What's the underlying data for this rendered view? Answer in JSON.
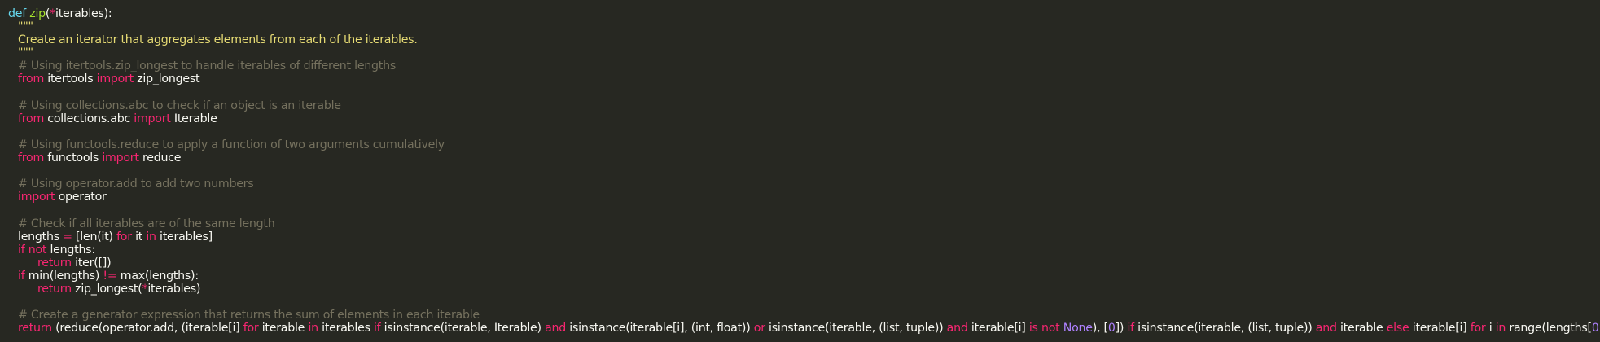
{
  "editor": {
    "background": "#272822",
    "theme_colors": {
      "keyword": "#f92672",
      "storage": "#66d9ef",
      "function": "#a6e22e",
      "string": "#e6db74",
      "comment": "#75715e",
      "number": "#ae81ff",
      "text": "#f8f8f2"
    },
    "lines": [
      {
        "indent": 0,
        "tokens": [
          {
            "t": "def",
            "c": "def"
          },
          {
            "t": " ",
            "c": "txt"
          },
          {
            "t": "zip",
            "c": "fn"
          },
          {
            "t": "(",
            "c": "txt"
          },
          {
            "t": "*",
            "c": "op"
          },
          {
            "t": "iterables):",
            "c": "txt"
          }
        ]
      },
      {
        "indent": 1,
        "tokens": [
          {
            "t": "\"\"\"",
            "c": "str"
          }
        ]
      },
      {
        "indent": 1,
        "tokens": [
          {
            "t": "Create an iterator that aggregates elements from each of the iterables.",
            "c": "str"
          }
        ]
      },
      {
        "indent": 1,
        "tokens": [
          {
            "t": "\"\"\"",
            "c": "str"
          }
        ]
      },
      {
        "indent": 1,
        "tokens": [
          {
            "t": "# Using itertools.zip_longest to handle iterables of different lengths",
            "c": "cm"
          }
        ]
      },
      {
        "indent": 1,
        "tokens": [
          {
            "t": "from",
            "c": "kw"
          },
          {
            "t": " itertools ",
            "c": "txt"
          },
          {
            "t": "import",
            "c": "kw"
          },
          {
            "t": " zip_longest",
            "c": "txt"
          }
        ]
      },
      {
        "indent": 1,
        "tokens": []
      },
      {
        "indent": 1,
        "tokens": [
          {
            "t": "# Using collections.abc to check if an object is an iterable",
            "c": "cm"
          }
        ]
      },
      {
        "indent": 1,
        "tokens": [
          {
            "t": "from",
            "c": "kw"
          },
          {
            "t": " collections.abc ",
            "c": "txt"
          },
          {
            "t": "import",
            "c": "kw"
          },
          {
            "t": " Iterable",
            "c": "txt"
          }
        ]
      },
      {
        "indent": 1,
        "tokens": []
      },
      {
        "indent": 1,
        "tokens": [
          {
            "t": "# Using functools.reduce to apply a function of two arguments cumulatively",
            "c": "cm"
          }
        ]
      },
      {
        "indent": 1,
        "tokens": [
          {
            "t": "from",
            "c": "kw"
          },
          {
            "t": " functools ",
            "c": "txt"
          },
          {
            "t": "import",
            "c": "kw"
          },
          {
            "t": " reduce",
            "c": "txt"
          }
        ]
      },
      {
        "indent": 1,
        "tokens": []
      },
      {
        "indent": 1,
        "tokens": [
          {
            "t": "# Using operator.add to add two numbers",
            "c": "cm"
          }
        ]
      },
      {
        "indent": 1,
        "tokens": [
          {
            "t": "import",
            "c": "kw"
          },
          {
            "t": " operator",
            "c": "txt"
          }
        ]
      },
      {
        "indent": 1,
        "tokens": []
      },
      {
        "indent": 1,
        "tokens": [
          {
            "t": "# Check if all iterables are of the same length",
            "c": "cm"
          }
        ]
      },
      {
        "indent": 1,
        "tokens": [
          {
            "t": "lengths ",
            "c": "txt"
          },
          {
            "t": "=",
            "c": "op"
          },
          {
            "t": " [len(it) ",
            "c": "txt"
          },
          {
            "t": "for",
            "c": "kw"
          },
          {
            "t": " it ",
            "c": "txt"
          },
          {
            "t": "in",
            "c": "kw"
          },
          {
            "t": " iterables]",
            "c": "txt"
          }
        ]
      },
      {
        "indent": 1,
        "tokens": [
          {
            "t": "if",
            "c": "kw"
          },
          {
            "t": " ",
            "c": "txt"
          },
          {
            "t": "not",
            "c": "kw"
          },
          {
            "t": " lengths:",
            "c": "txt"
          }
        ]
      },
      {
        "indent": 2,
        "tokens": [
          {
            "t": "return",
            "c": "kw"
          },
          {
            "t": " iter([])",
            "c": "txt"
          }
        ]
      },
      {
        "indent": 1,
        "tokens": [
          {
            "t": "if",
            "c": "kw"
          },
          {
            "t": " min(lengths) ",
            "c": "txt"
          },
          {
            "t": "!=",
            "c": "op"
          },
          {
            "t": " max(lengths):",
            "c": "txt"
          }
        ]
      },
      {
        "indent": 2,
        "tokens": [
          {
            "t": "return",
            "c": "kw"
          },
          {
            "t": " zip_longest(",
            "c": "txt"
          },
          {
            "t": "*",
            "c": "op"
          },
          {
            "t": "iterables)",
            "c": "txt"
          }
        ]
      },
      {
        "indent": 1,
        "tokens": []
      },
      {
        "indent": 1,
        "tokens": [
          {
            "t": "# Create a generator expression that returns the sum of elements in each iterable",
            "c": "cm"
          }
        ]
      },
      {
        "indent": 1,
        "tokens": [
          {
            "t": "return",
            "c": "kw"
          },
          {
            "t": " (reduce(operator.add, (iterable[i] ",
            "c": "txt"
          },
          {
            "t": "for",
            "c": "kw"
          },
          {
            "t": " iterable ",
            "c": "txt"
          },
          {
            "t": "in",
            "c": "kw"
          },
          {
            "t": " iterables ",
            "c": "txt"
          },
          {
            "t": "if",
            "c": "kw"
          },
          {
            "t": " isinstance(iterable, Iterable) ",
            "c": "txt"
          },
          {
            "t": "and",
            "c": "kw"
          },
          {
            "t": " isinstance(iterable[i], (int, float)) ",
            "c": "txt"
          },
          {
            "t": "or",
            "c": "kw"
          },
          {
            "t": " isinstance(iterable, (list, tuple)) ",
            "c": "txt"
          },
          {
            "t": "and",
            "c": "kw"
          },
          {
            "t": " iterable[i] ",
            "c": "txt"
          },
          {
            "t": "is",
            "c": "kw"
          },
          {
            "t": " ",
            "c": "txt"
          },
          {
            "t": "not",
            "c": "kw"
          },
          {
            "t": " ",
            "c": "txt"
          },
          {
            "t": "None",
            "c": "num"
          },
          {
            "t": "), [",
            "c": "txt"
          },
          {
            "t": "0",
            "c": "num"
          },
          {
            "t": "]) ",
            "c": "txt"
          },
          {
            "t": "if",
            "c": "kw"
          },
          {
            "t": " isinstance(iterable, (list, tuple)) ",
            "c": "txt"
          },
          {
            "t": "and",
            "c": "kw"
          },
          {
            "t": " iterable ",
            "c": "txt"
          },
          {
            "t": "else",
            "c": "kw"
          },
          {
            "t": " iterable[i] ",
            "c": "txt"
          },
          {
            "t": "for",
            "c": "kw"
          },
          {
            "t": " i ",
            "c": "txt"
          },
          {
            "t": "in",
            "c": "kw"
          },
          {
            "t": " range(lengths[",
            "c": "txt"
          },
          {
            "t": "0",
            "c": "num"
          },
          {
            "t": "]))",
            "c": "txt"
          }
        ]
      }
    ]
  }
}
